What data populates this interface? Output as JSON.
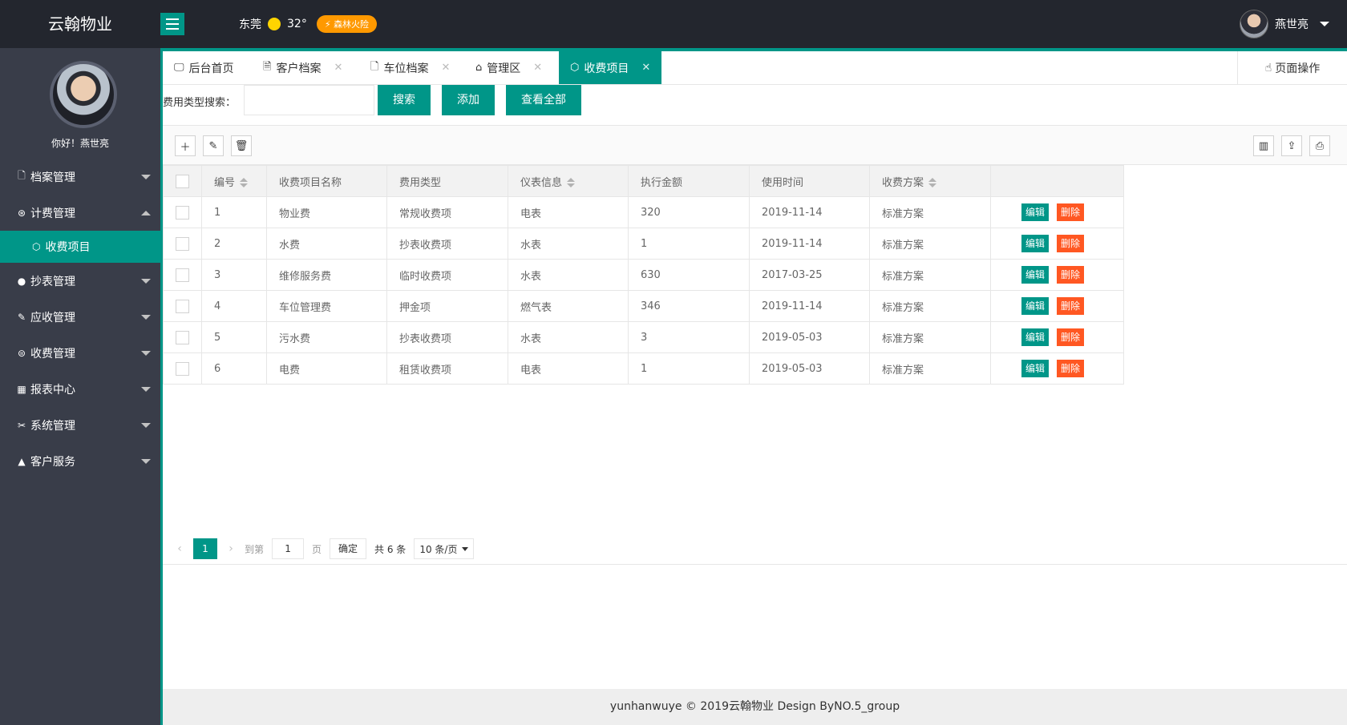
{
  "header": {
    "logo": "云翰物业",
    "city": "东莞",
    "temperature": "32°",
    "alert": "森林火险",
    "username": "燕世亮"
  },
  "sidebar": {
    "greeting": "你好！燕世亮",
    "items": [
      {
        "label": "档案管理",
        "icon": "file-icon"
      },
      {
        "label": "计费管理",
        "icon": "yen-icon"
      },
      {
        "label": "抄表管理",
        "icon": "gauge-icon"
      },
      {
        "label": "应收管理",
        "icon": "invoice-icon"
      },
      {
        "label": "收费管理",
        "icon": "coin-icon"
      },
      {
        "label": "报表中心",
        "icon": "chart-icon"
      },
      {
        "label": "系统管理",
        "icon": "tools-icon"
      },
      {
        "label": "客户服务",
        "icon": "user-icon"
      }
    ],
    "active_sub": {
      "label": "收费项目",
      "icon": "cube-icon"
    }
  },
  "tabs": [
    {
      "label": "后台首页"
    },
    {
      "label": "客户档案"
    },
    {
      "label": "车位档案"
    },
    {
      "label": "管理区"
    },
    {
      "label": "收费项目"
    }
  ],
  "page_op": "页面操作",
  "search": {
    "label": "费用类型搜索：",
    "value": "",
    "search_btn": "搜索",
    "add_btn": "添加",
    "view_all_btn": "查看全部"
  },
  "table": {
    "headers": [
      "编号",
      "收费项目名称",
      "费用类型",
      "仪表信息",
      "执行金额",
      "使用时间",
      "收费方案"
    ],
    "rows": [
      [
        "1",
        "物业费",
        "常规收费项",
        "电表",
        "320",
        "2019-11-14",
        "标准方案"
      ],
      [
        "2",
        "水费",
        "抄表收费项",
        "水表",
        "1",
        "2019-11-14",
        "标准方案"
      ],
      [
        "3",
        "维修服务费",
        "临时收费项",
        "水表",
        "630",
        "2017-03-25",
        "标准方案"
      ],
      [
        "4",
        "车位管理费",
        "押金项",
        "燃气表",
        "346",
        "2019-11-14",
        "标准方案"
      ],
      [
        "5",
        "污水费",
        "抄表收费项",
        "水表",
        "3",
        "2019-05-03",
        "标准方案"
      ],
      [
        "6",
        "电费",
        "租赁收费项",
        "电表",
        "1",
        "2019-05-03",
        "标准方案"
      ]
    ],
    "edit_label": "编辑",
    "delete_label": "删除"
  },
  "pager": {
    "current": "1",
    "goto_label": "到第",
    "goto_value": "1",
    "page_unit": "页",
    "ok_label": "确定",
    "total": "共 6 条",
    "page_size": "10 条/页"
  },
  "footer": "yunhanwuye © 2019云翰物业 Design ByNO.5_group",
  "colors": {
    "accent": "#009688",
    "danger": "#ff5722",
    "sidebar": "#393d49",
    "header": "#23262e",
    "alert": "#ff9900"
  }
}
